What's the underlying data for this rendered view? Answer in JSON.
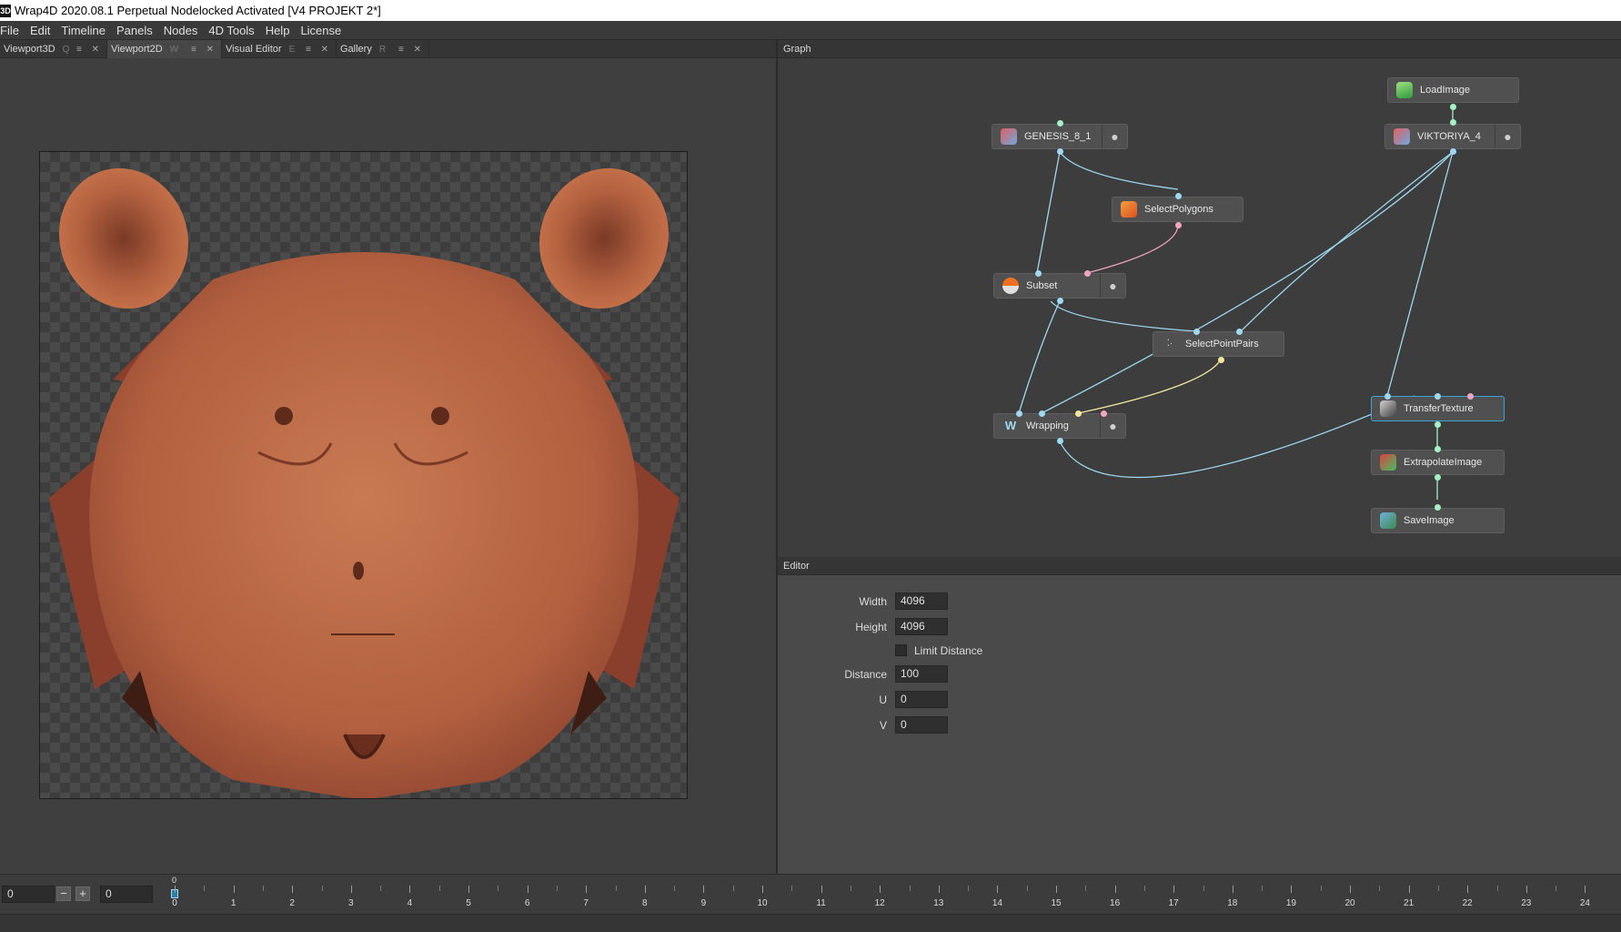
{
  "window": {
    "title": "Wrap4D 2020.08.1  Perpetual Nodelocked Activated  [V4 PROJEKT 2*]",
    "app_icon": "3D"
  },
  "menu": [
    "File",
    "Edit",
    "Timeline",
    "Panels",
    "Nodes",
    "4D Tools",
    "Help",
    "License"
  ],
  "left_tabs": [
    {
      "label": "Viewport3D",
      "hotkey": "Q",
      "active": false
    },
    {
      "label": "Viewport2D",
      "hotkey": "W",
      "active": true
    },
    {
      "label": "Visual Editor",
      "hotkey": "E",
      "active": false
    },
    {
      "label": "Gallery",
      "hotkey": "R",
      "active": false
    }
  ],
  "tab_controls": "≡ ✕",
  "graph": {
    "title": "Graph",
    "nodes": [
      {
        "id": "genesis",
        "label": "GENESIS_8_1",
        "icon": "mesh-icon",
        "has_visibility": true
      },
      {
        "id": "loadimage",
        "label": "LoadImage",
        "icon": "image-icon",
        "has_visibility": false
      },
      {
        "id": "viktoriya",
        "label": "VIKTORIYA_4",
        "icon": "mesh-icon",
        "has_visibility": true
      },
      {
        "id": "selectpolygons",
        "label": "SelectPolygons",
        "icon": "select-polygons-icon",
        "has_visibility": false
      },
      {
        "id": "subset",
        "label": "Subset",
        "icon": "subset-icon",
        "has_visibility": true
      },
      {
        "id": "selectpointpairs",
        "label": "SelectPointPairs",
        "icon": "point-pairs-icon",
        "has_visibility": false
      },
      {
        "id": "wrapping",
        "label": "Wrapping",
        "icon": "wrapping-icon",
        "has_visibility": true
      },
      {
        "id": "transfertexture",
        "label": "TransferTexture",
        "icon": "transfer-texture-icon",
        "has_visibility": false
      },
      {
        "id": "extrapolateimage",
        "label": "ExtrapolateImage",
        "icon": "extrapolate-image-icon",
        "has_visibility": false
      },
      {
        "id": "saveimage",
        "label": "SaveImage",
        "icon": "save-image-icon",
        "has_visibility": false
      }
    ]
  },
  "editor": {
    "title": "Editor",
    "width_label": "Width",
    "width_value": "4096",
    "height_label": "Height",
    "height_value": "4096",
    "limit_distance_label": "Limit Distance",
    "limit_distance_checked": false,
    "distance_label": "Distance",
    "distance_value": "100",
    "u_label": "U",
    "u_value": "0",
    "v_label": "V",
    "v_value": "0"
  },
  "timeline": {
    "current_frame": "0",
    "end_frame": "0",
    "minus": "−",
    "plus": "+",
    "cursor_label": "0",
    "ticks": [
      "0",
      "1",
      "2",
      "3",
      "4",
      "5",
      "6",
      "7",
      "8",
      "9",
      "10",
      "11",
      "12",
      "13",
      "14",
      "15",
      "16",
      "17",
      "18",
      "19",
      "20",
      "21",
      "22",
      "23",
      "24"
    ]
  },
  "colors": {
    "accent": "#3aa6d6",
    "port_blue": "#9fd8f0",
    "port_pink": "#f0a6c2",
    "port_yellow": "#f0e6a0",
    "skin": "#b86a48"
  }
}
